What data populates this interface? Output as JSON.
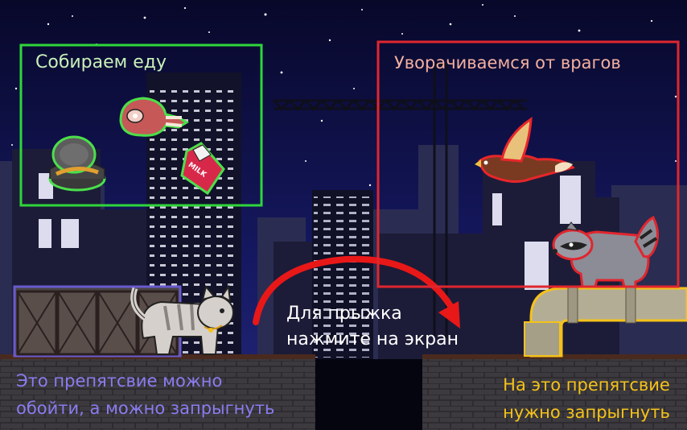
{
  "colors": {
    "sky": "#0b0b2e",
    "food_frame": "#2fd63a",
    "enemy_frame": "#e0262e",
    "left_caption": "#8a7cf0",
    "right_caption": "#f5c21a",
    "jump_arrow": "#e81818"
  },
  "hints": {
    "collect_food": "Собираем еду",
    "avoid_enemies": "Уворачиваемся от врагов",
    "jump_line1": "Для прыжка",
    "jump_line2": "нажмите на экран",
    "left_line1": "Это препятсвие можно",
    "left_line2": "обойти, а можно запрыгнуть",
    "right_line1": "На это препятсвие",
    "right_line2": "нужно запрыгнуть"
  },
  "food_items": [
    "canned-fish-icon",
    "ham-icon",
    "milk-carton-icon"
  ],
  "milk_label": "MILK",
  "enemies": [
    "bird-icon",
    "raccoon-icon"
  ],
  "player": "cat-icon",
  "obstacles": [
    "crate-stack",
    "pipe"
  ]
}
